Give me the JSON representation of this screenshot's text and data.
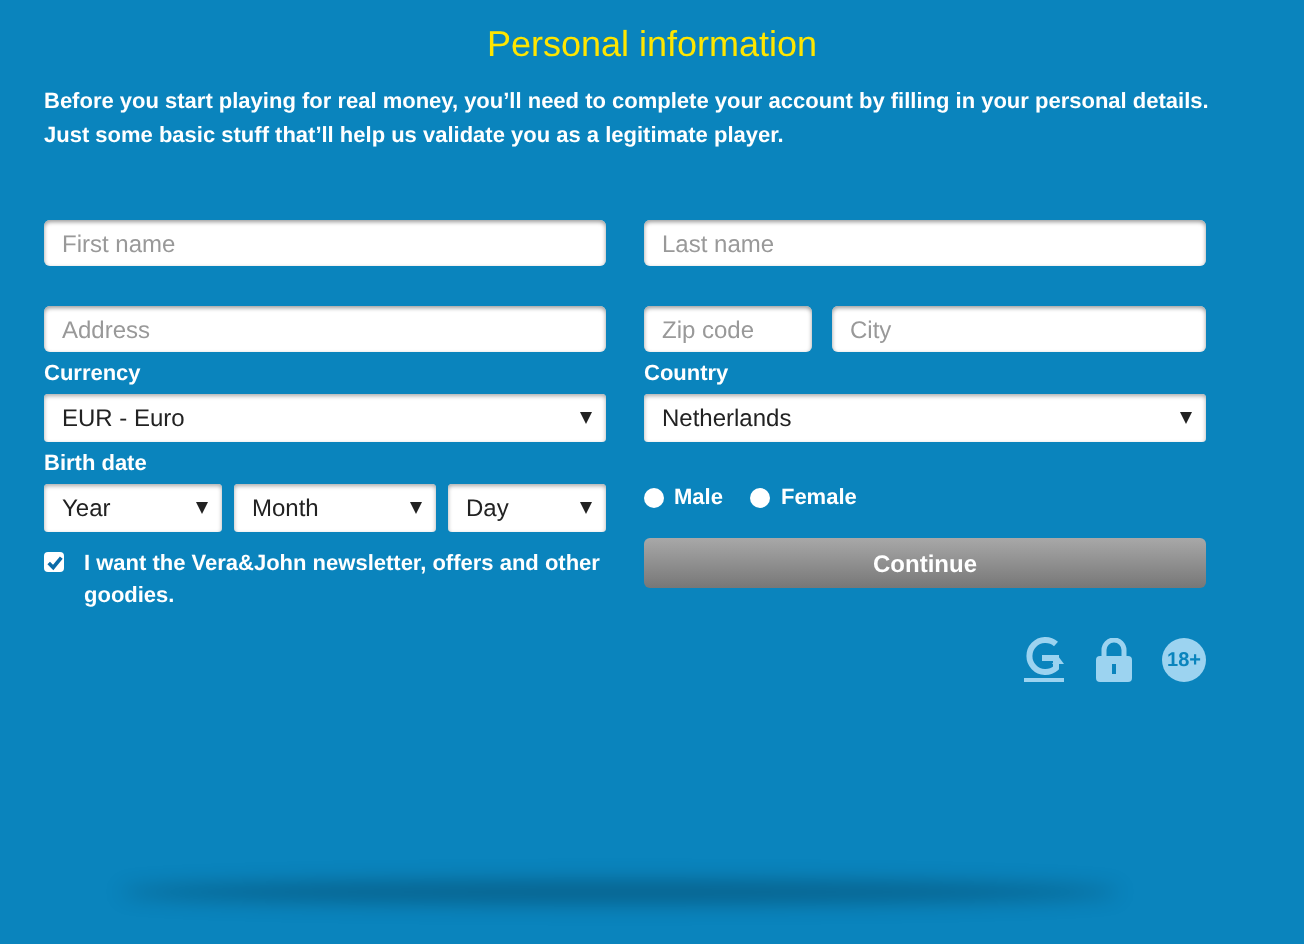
{
  "title": "Personal information",
  "intro": "Before you start playing for real money, you’ll need to complete your account by filling in your personal details. Just some basic stuff that’ll help us validate you as a legitimate player.",
  "first_name": {
    "placeholder": "First name"
  },
  "last_name": {
    "placeholder": "Last name"
  },
  "address": {
    "placeholder": "Address"
  },
  "zip_code": {
    "placeholder": "Zip code"
  },
  "city": {
    "placeholder": "City"
  },
  "currency": {
    "label": "Currency",
    "value": "EUR - Euro"
  },
  "country": {
    "label": "Country",
    "value": "Netherlands"
  },
  "birth_date": {
    "label": "Birth date",
    "selects": [
      {
        "value": "Year"
      },
      {
        "value": "Month"
      },
      {
        "value": "Day"
      }
    ]
  },
  "gender": [
    {
      "label": "Male",
      "selected": false
    },
    {
      "label": "Female",
      "selected": false
    }
  ],
  "newsletter": {
    "label": "I want the Vera&John newsletter, offers and other goodies.",
    "checked": true
  },
  "continue_button": "Continue",
  "age_badge": "18+"
}
